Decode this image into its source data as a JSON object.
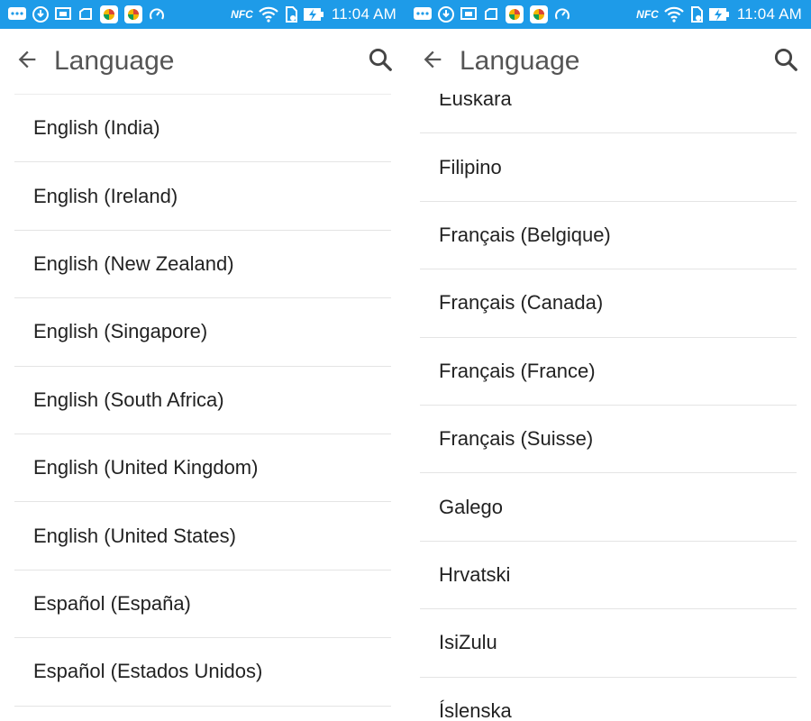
{
  "status_bar": {
    "time": "11:04 AM",
    "nfc_text": "NFC",
    "color": "#1e9be8",
    "icons": [
      "chat-icon",
      "download-icon",
      "screen-icon",
      "recent-icon",
      "app-icon",
      "app-icon",
      "speed-icon",
      "nfc-icon",
      "wifi-icon",
      "sdcard-icon",
      "battery-charging-icon"
    ]
  },
  "screens": [
    {
      "title": "Language",
      "items": [
        "English (India)",
        "English (Ireland)",
        "English (New Zealand)",
        "English (Singapore)",
        "English (South Africa)",
        "English (United Kingdom)",
        "English (United States)",
        "Español (España)",
        "Español (Estados Unidos)"
      ]
    },
    {
      "title": "Language",
      "items": [
        "Euskara",
        "Filipino",
        "Français (Belgique)",
        "Français (Canada)",
        "Français (France)",
        "Français (Suisse)",
        "Galego",
        "Hrvatski",
        "IsiZulu",
        "Íslenska"
      ]
    }
  ]
}
